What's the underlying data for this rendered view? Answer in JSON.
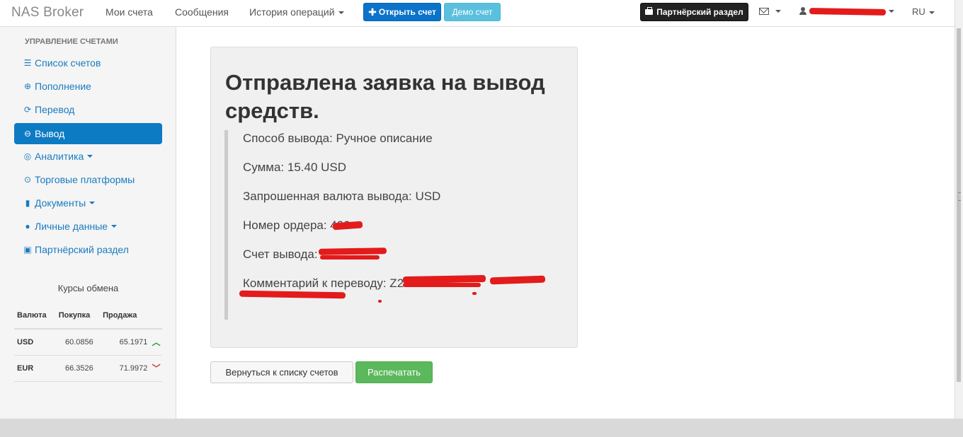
{
  "navbar": {
    "brand": "NAS Broker",
    "links": [
      "Мои счета",
      "Сообщения",
      "История операций"
    ],
    "open_account_label": "Открыть счет",
    "demo_account_label": "Демо счет",
    "partner_label": "Партнёрский раздел",
    "language": "RU"
  },
  "sidebar": {
    "heading": "Управление счетами",
    "items": [
      {
        "label": "Список счетов",
        "icon": "list-icon"
      },
      {
        "label": "Пополнение",
        "icon": "plus-circle-icon"
      },
      {
        "label": "Перевод",
        "icon": "refresh-icon"
      },
      {
        "label": "Вывод",
        "icon": "minus-circle-icon"
      },
      {
        "label": "Аналитика",
        "icon": "compass-icon"
      },
      {
        "label": "Торговые платформы",
        "icon": "download-circle-icon"
      },
      {
        "label": "Документы",
        "icon": "file-icon"
      },
      {
        "label": "Личные данные",
        "icon": "user-icon"
      },
      {
        "label": "Партнёрский раздел",
        "icon": "briefcase-icon"
      }
    ],
    "active_index": 3
  },
  "rates": {
    "title": "Курсы обмена",
    "headers": [
      "Валюта",
      "Покупка",
      "Продажа"
    ],
    "rows": [
      {
        "currency": "USD",
        "buy": "60.0856",
        "sell": "65.1971",
        "trend": "up"
      },
      {
        "currency": "EUR",
        "buy": "66.3526",
        "sell": "71.9972",
        "trend": "down"
      }
    ]
  },
  "main": {
    "title": "Отправлена заявка на вывод средств.",
    "details": [
      "Способ вывода: Ручное описание",
      "Сумма: 15.40 USD",
      "Запрошенная валюта вывода: USD",
      "Номер ордера: 409",
      "Счет вывода:",
      "Комментарий к переводу: Z2"
    ],
    "back_button": "Вернуться к списку счетов",
    "print_button": "Распечатать"
  },
  "colors": {
    "primary": "#0b73c9",
    "info": "#5bc0de",
    "success": "#5cb85c",
    "active_nav": "#0d7bc3",
    "redaction": "#e31b1b"
  }
}
